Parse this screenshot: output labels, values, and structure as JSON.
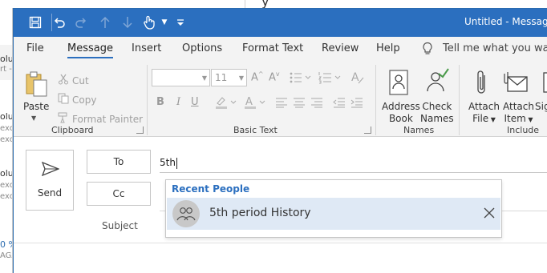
{
  "background": {
    "top_text": "y",
    "left_fragments": [
      "olum",
      "rt - @",
      "olu",
      "exc",
      "exc",
      "olu",
      "exc",
      "exc",
      "0 %",
      "AGA"
    ]
  },
  "titlebar": {
    "title": "Untitled - Message",
    "accent_color": "#2b6fbf",
    "quick_access_icons": [
      "save-icon",
      "undo-icon",
      "redo-icon",
      "up-arrow-icon",
      "down-arrow-icon",
      "touch-mode-icon",
      "customize-toolbar-icon"
    ]
  },
  "tabs": {
    "items": [
      "File",
      "Message",
      "Insert",
      "Options",
      "Format Text",
      "Review",
      "Help"
    ],
    "active": "Message",
    "tell_me": "Tell me what you want"
  },
  "ribbon": {
    "clipboard": {
      "paste": "Paste",
      "cut": "Cut",
      "copy": "Copy",
      "format_painter": "Format Painter",
      "label": "Clipboard"
    },
    "basic_text": {
      "font_size": "11",
      "bold": "B",
      "italic": "I",
      "underline": "U",
      "label": "Basic Text"
    },
    "names": {
      "address_book_line1": "Address",
      "address_book_line2": "Book",
      "check_names_line1": "Check",
      "check_names_line2": "Names",
      "label": "Names"
    },
    "include": {
      "attach_file_line1": "Attach",
      "attach_file_line2": "File",
      "attach_item_line1": "Attach",
      "attach_item_line2": "Item",
      "signature_line1": "Sig",
      "label": "Include"
    }
  },
  "compose": {
    "send": "Send",
    "to": "To",
    "cc": "Cc",
    "subject": "Subject",
    "to_value": "5th"
  },
  "autocomplete": {
    "heading": "Recent People",
    "items": [
      {
        "name": "5th period History"
      }
    ]
  }
}
